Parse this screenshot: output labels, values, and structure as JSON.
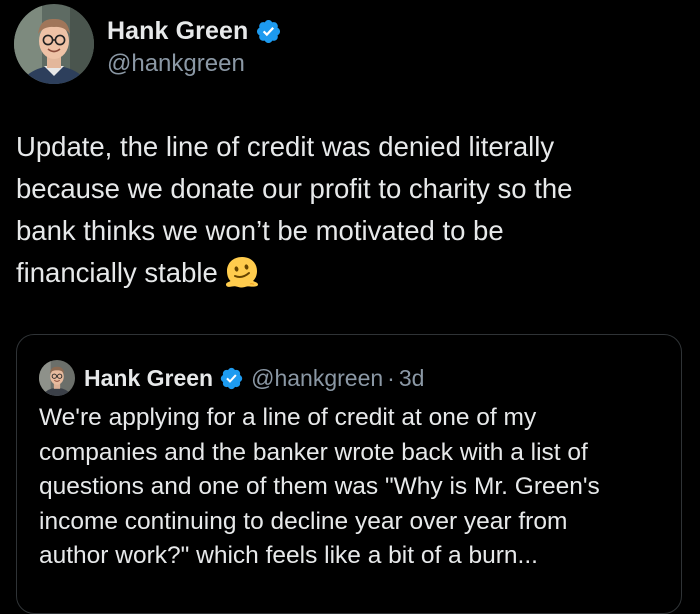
{
  "author": {
    "display_name": "Hank Green",
    "handle": "@hankgreen",
    "verified": true,
    "avatar_icon": "profile-photo-man-glasses"
  },
  "tweet": {
    "text": "Update, the line of credit was denied literally\nbecause we donate our profit to charity so the\nbank thinks we won’t be motivated to be\nfinancially stable",
    "emoji_icon": "face-melting-emoji"
  },
  "quoted_tweet": {
    "display_name": "Hank Green",
    "handle": "@hankgreen",
    "separator": "·",
    "time": "3d",
    "verified": true,
    "text": "We're applying for a line of credit at one of my\ncompanies and the banker wrote back with a list of\nquestions and one of them was \"Why is Mr. Green's\nincome continuing to decline year over year from\nauthor work?\" which feels like a bit of a burn..."
  },
  "colors": {
    "background": "#000000",
    "primary_text": "#e7e9ea",
    "secondary_text": "#8b98a5",
    "verified_blue": "#1d9bf0",
    "card_border": "#2f3336"
  }
}
